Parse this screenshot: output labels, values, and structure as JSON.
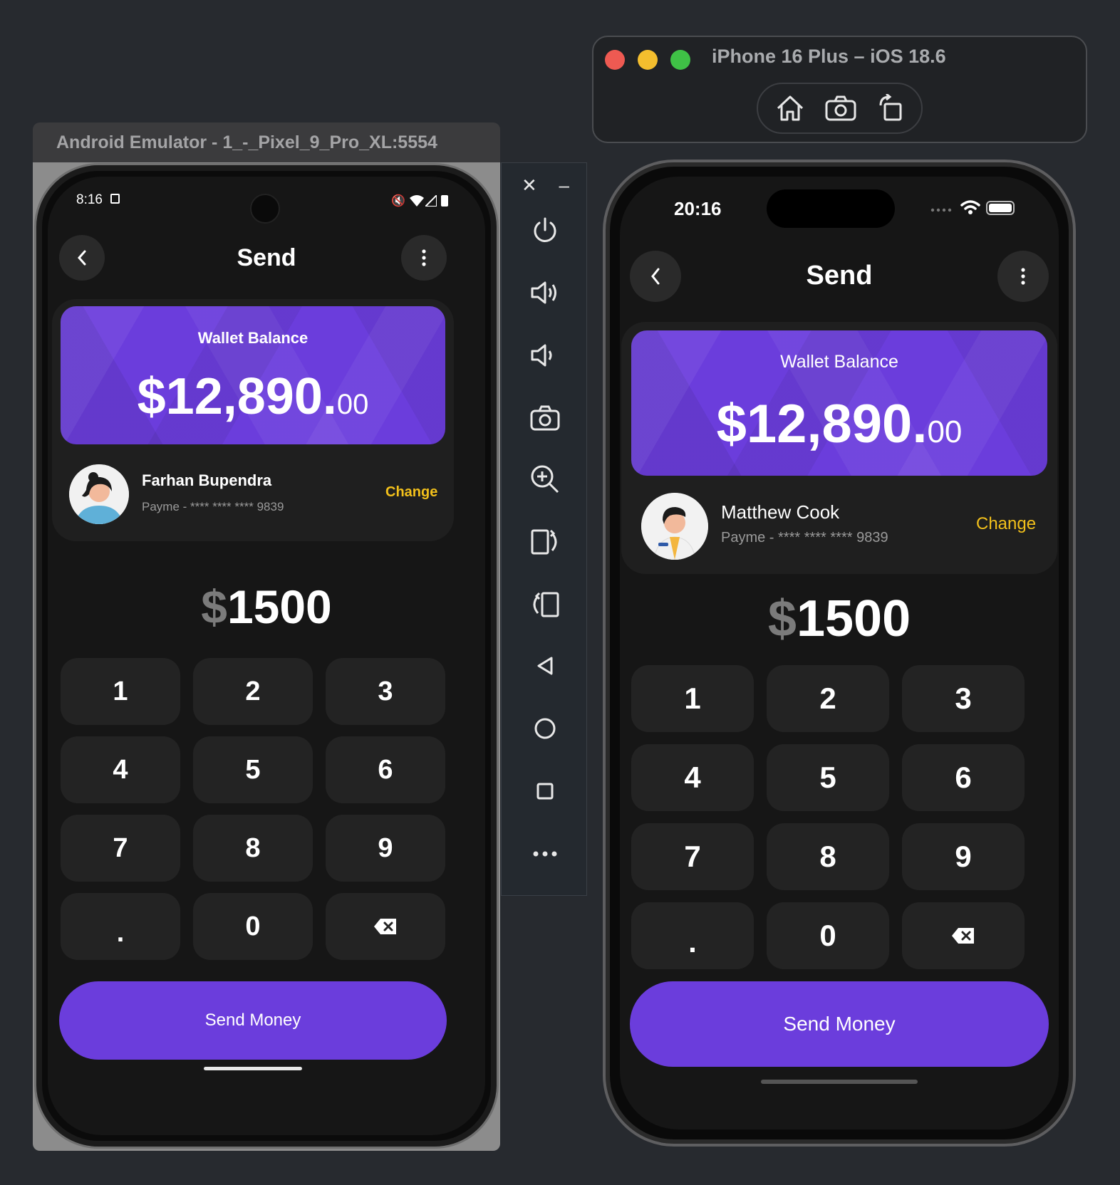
{
  "android": {
    "window_title": "Android Emulator - 1_-_Pixel_9_Pro_XL:5554",
    "status_time": "8:16",
    "toolbar": [
      "close-icon",
      "minimize-icon",
      "power-icon",
      "volume-up-icon",
      "volume-down-icon",
      "camera-icon",
      "zoom-icon",
      "rotate-left-icon",
      "rotate-right-icon",
      "back-icon",
      "home-icon",
      "overview-icon",
      "more-icon"
    ],
    "close_label": "✕",
    "minimize_label": "–",
    "app": {
      "title": "Send",
      "wallet_label": "Wallet Balance",
      "wallet_main": "$12,890.",
      "wallet_cents": "00",
      "recipient_name": "Farhan Bupendra",
      "recipient_account": "Payme - **** **** **** 9839",
      "change_label": "Change",
      "currency": "$",
      "amount": "1500",
      "keys": [
        "1",
        "2",
        "3",
        "4",
        "5",
        "6",
        "7",
        "8",
        "9",
        ".",
        "0",
        "⌫"
      ],
      "send_label": "Send Money"
    }
  },
  "ios": {
    "window_title": "iPhone 16 Plus – iOS 18.6",
    "status_time": "20:16",
    "app": {
      "title": "Send",
      "wallet_label": "Wallet Balance",
      "wallet_main": "$12,890.",
      "wallet_cents": "00",
      "recipient_name": "Matthew Cook",
      "recipient_account": "Payme - **** **** **** 9839",
      "change_label": "Change",
      "currency": "$",
      "amount": "1500",
      "keys": [
        "1",
        "2",
        "3",
        "4",
        "5",
        "6",
        "7",
        "8",
        "9",
        ".",
        "0",
        "⌫"
      ],
      "send_label": "Send Money"
    }
  },
  "colors": {
    "accent": "#6b3ddc",
    "change": "#f2c01b",
    "background": "#161616",
    "key": "#232323"
  }
}
